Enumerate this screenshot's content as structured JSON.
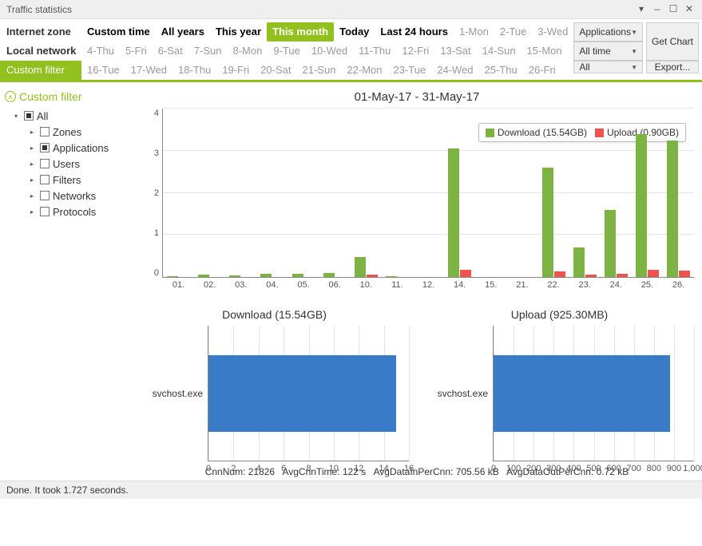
{
  "window_title": "Traffic statistics",
  "zones": [
    "Internet zone",
    "Local network zone",
    "Custom filter"
  ],
  "zone_active": 2,
  "period_row1": [
    {
      "label": "Custom time",
      "bold": true
    },
    {
      "label": "All years",
      "bold": true
    },
    {
      "label": "This year",
      "bold": true
    },
    {
      "label": "This month",
      "active": true
    },
    {
      "label": "Today",
      "bold": true
    },
    {
      "label": "Last 24 hours",
      "bold": true
    },
    {
      "label": "1-Mon"
    },
    {
      "label": "2-Tue"
    },
    {
      "label": "3-Wed"
    }
  ],
  "period_row2": [
    "4-Thu",
    "5-Fri",
    "6-Sat",
    "7-Sun",
    "8-Mon",
    "9-Tue",
    "10-Wed",
    "11-Thu",
    "12-Fri",
    "13-Sat",
    "14-Sun",
    "15-Mon"
  ],
  "period_row3": [
    "16-Tue",
    "17-Wed",
    "18-Thu",
    "19-Fri",
    "20-Sat",
    "21-Sun",
    "22-Mon",
    "23-Tue",
    "24-Wed",
    "25-Thu",
    "26-Fri"
  ],
  "combo_app": "Applications",
  "combo_time": "All time",
  "combo_all": "All",
  "btn_getchart": "Get Chart",
  "btn_export": "Export...",
  "tree_header": "Custom filter",
  "tree": [
    {
      "label": "All",
      "ind": true,
      "expanded": true
    },
    {
      "label": "Zones"
    },
    {
      "label": "Applications",
      "ind": true
    },
    {
      "label": "Users"
    },
    {
      "label": "Filters"
    },
    {
      "label": "Networks"
    },
    {
      "label": "Protocols"
    }
  ],
  "chart_data": {
    "type": "bar",
    "title": "01-May-17 - 31-May-17",
    "ylim": [
      0,
      4
    ],
    "yticks": [
      0,
      1,
      2,
      3,
      4
    ],
    "categories": [
      "01.",
      "02.",
      "03.",
      "04.",
      "05.",
      "06.",
      "10.",
      "11.",
      "12.",
      "14.",
      "15.",
      "21.",
      "22.",
      "23.",
      "24.",
      "25.",
      "26."
    ],
    "series": [
      {
        "name": "Download (15.54GB)",
        "color": "#7cb342",
        "values": [
          0.02,
          0.06,
          0.03,
          0.08,
          0.07,
          0.09,
          0.48,
          0.01,
          0,
          3.05,
          0,
          0,
          2.6,
          0.7,
          1.6,
          3.4,
          3.25
        ]
      },
      {
        "name": "Upload (0.90GB)",
        "color": "#ef5350",
        "values": [
          0,
          0,
          0,
          0,
          0,
          0,
          0.05,
          0,
          0,
          0.18,
          0,
          0,
          0.14,
          0.05,
          0.08,
          0.18,
          0.16
        ]
      }
    ]
  },
  "hbar1": {
    "title": "Download (15.54GB)",
    "cat": "svchost.exe",
    "xlim": [
      0,
      16
    ],
    "xticks": [
      0,
      2,
      4,
      6,
      8,
      10,
      12,
      14,
      16
    ],
    "value": 15.0
  },
  "hbar2": {
    "title": "Upload (925.30MB)",
    "cat": "svchost.exe",
    "xlim": [
      0,
      1000
    ],
    "xticks": [
      0,
      100,
      200,
      300,
      400,
      500,
      600,
      700,
      800,
      900,
      1000
    ],
    "value": 880
  },
  "stats": {
    "cnn": "CnnNum: 21826",
    "avgtime": "AvgCnnTime: 122 s",
    "avgin": "AvgDataInPerCnn: 705.56 kB",
    "avgout": "AvgDataOutPerCnn: 0.72 kB"
  },
  "status": "Done. It took 1.727 seconds."
}
